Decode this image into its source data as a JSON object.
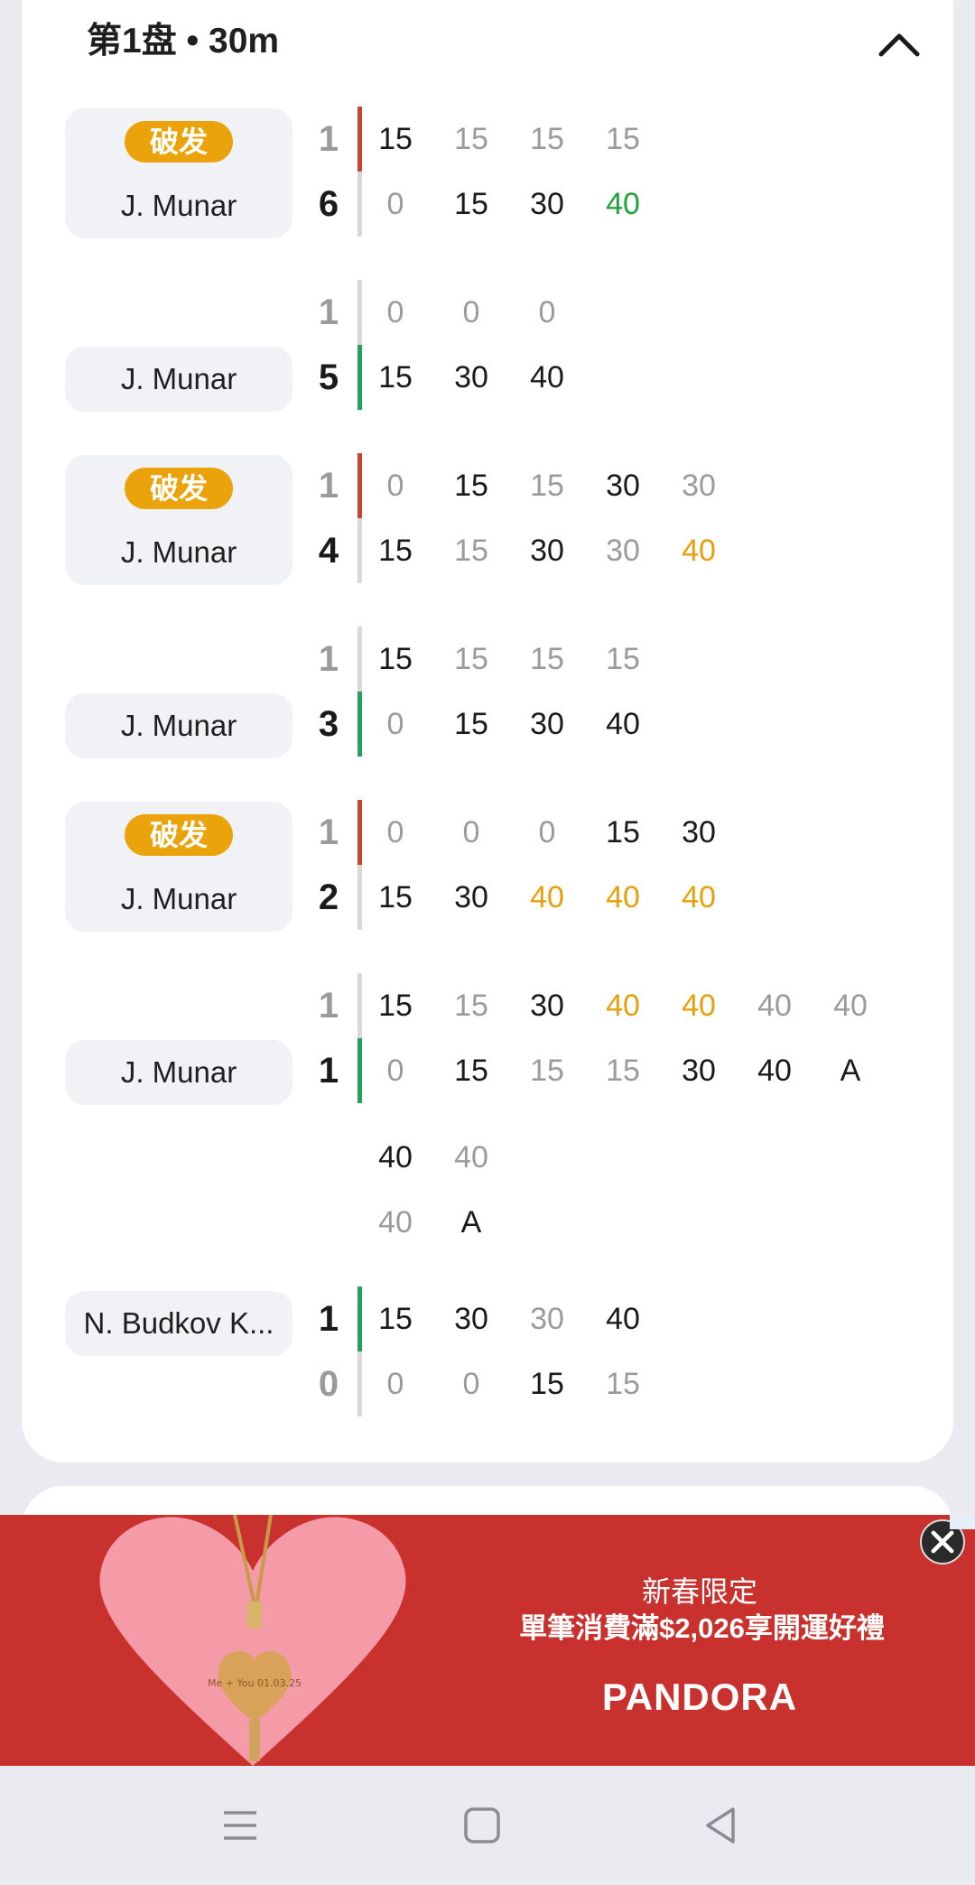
{
  "set": {
    "title": "第1盘 • 30m"
  },
  "break_label": "破发",
  "games": [
    {
      "player": "J. Munar",
      "break": true,
      "score_top": "1",
      "score_bottom": "6",
      "server": "top",
      "top": [
        [
          "15",
          "dark"
        ],
        [
          "15",
          "dim"
        ],
        [
          "15",
          "dim"
        ],
        [
          "15",
          "dim"
        ]
      ],
      "bottom": [
        [
          "0",
          "dim"
        ],
        [
          "15",
          "dark"
        ],
        [
          "30",
          "dark"
        ],
        [
          "40",
          "green"
        ]
      ]
    },
    {
      "player": "J. Munar",
      "break": false,
      "score_top": "1",
      "score_bottom": "5",
      "server": "bottom",
      "top": [
        [
          "0",
          "dim"
        ],
        [
          "0",
          "dim"
        ],
        [
          "0",
          "dim"
        ]
      ],
      "bottom": [
        [
          "15",
          "dark"
        ],
        [
          "30",
          "dark"
        ],
        [
          "40",
          "dark"
        ]
      ]
    },
    {
      "player": "J. Munar",
      "break": true,
      "score_top": "1",
      "score_bottom": "4",
      "server": "top",
      "top": [
        [
          "0",
          "dim"
        ],
        [
          "15",
          "dark"
        ],
        [
          "15",
          "dim"
        ],
        [
          "30",
          "dark"
        ],
        [
          "30",
          "dim"
        ]
      ],
      "bottom": [
        [
          "15",
          "dark"
        ],
        [
          "15",
          "dim"
        ],
        [
          "30",
          "dark"
        ],
        [
          "30",
          "dim"
        ],
        [
          "40",
          "orange"
        ]
      ]
    },
    {
      "player": "J. Munar",
      "break": false,
      "score_top": "1",
      "score_bottom": "3",
      "server": "bottom",
      "top": [
        [
          "15",
          "dark"
        ],
        [
          "15",
          "dim"
        ],
        [
          "15",
          "dim"
        ],
        [
          "15",
          "dim"
        ]
      ],
      "bottom": [
        [
          "0",
          "dim"
        ],
        [
          "15",
          "dark"
        ],
        [
          "30",
          "dark"
        ],
        [
          "40",
          "dark"
        ]
      ]
    },
    {
      "player": "J. Munar",
      "break": true,
      "score_top": "1",
      "score_bottom": "2",
      "server": "top",
      "top": [
        [
          "0",
          "dim"
        ],
        [
          "0",
          "dim"
        ],
        [
          "0",
          "dim"
        ],
        [
          "15",
          "dark"
        ],
        [
          "30",
          "dark"
        ]
      ],
      "bottom": [
        [
          "15",
          "dark"
        ],
        [
          "30",
          "dark"
        ],
        [
          "40",
          "orange"
        ],
        [
          "40",
          "orange"
        ],
        [
          "40",
          "orange"
        ]
      ]
    },
    {
      "player": "J. Munar",
      "break": false,
      "score_top": "1",
      "score_bottom": "1",
      "server": "bottom",
      "top": [
        [
          "15",
          "dark"
        ],
        [
          "15",
          "dim"
        ],
        [
          "30",
          "dark"
        ],
        [
          "40",
          "orange"
        ],
        [
          "40",
          "orange"
        ],
        [
          "40",
          "dim"
        ],
        [
          "40",
          "dim"
        ]
      ],
      "bottom": [
        [
          "0",
          "dim"
        ],
        [
          "15",
          "dark"
        ],
        [
          "15",
          "dim"
        ],
        [
          "15",
          "dim"
        ],
        [
          "30",
          "dark"
        ],
        [
          "40",
          "dark"
        ],
        [
          "A",
          "dark"
        ]
      ],
      "top_cont": [
        [
          "40",
          "dark"
        ],
        [
          "40",
          "dim"
        ]
      ],
      "bottom_cont": [
        [
          "40",
          "dim"
        ],
        [
          "A",
          "dark"
        ]
      ]
    },
    {
      "player": "N. Budkov K...",
      "break": false,
      "score_top": "1",
      "score_bottom": "0",
      "server": "top_green",
      "top": [
        [
          "15",
          "dark"
        ],
        [
          "30",
          "dark"
        ],
        [
          "30",
          "dim"
        ],
        [
          "40",
          "dark"
        ]
      ],
      "bottom": [
        [
          "0",
          "dim"
        ],
        [
          "0",
          "dim"
        ],
        [
          "15",
          "dark"
        ],
        [
          "15",
          "dim"
        ]
      ]
    }
  ],
  "ad": {
    "line1": "新春限定",
    "line2": "單筆消費滿$2,026享開運好禮",
    "brand": "PANDORA",
    "engraving": "Me + You 01.03.25"
  },
  "icons": {
    "collapse": "chevron-up-icon",
    "close": "close-icon",
    "nav_menu": "menu-icon",
    "nav_home": "home-square-icon",
    "nav_back": "back-triangle-icon"
  },
  "colors": {
    "break_tag": "#eba30c",
    "server_lost": "#c8452f",
    "server_held": "#23a35a",
    "game_point_win": "#1fa33a",
    "break_point": "#e5a00d",
    "ad_background": "#c8312d"
  }
}
